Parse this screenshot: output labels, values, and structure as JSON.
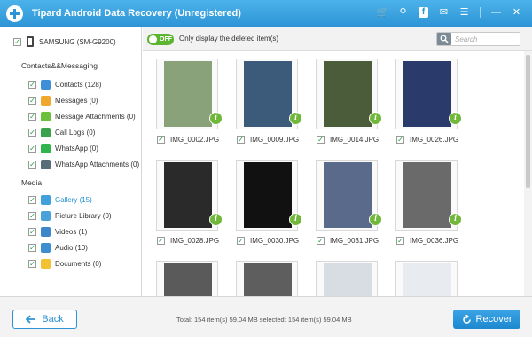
{
  "app": {
    "title": "Tipard Android Data Recovery (Unregistered)"
  },
  "device": {
    "name": "SAMSUNG (SM-G9200)"
  },
  "sidebar": {
    "contacts_section": "Contacts&&Messaging",
    "media_section": "Media",
    "contacts_items": [
      {
        "label": "Contacts (128)",
        "icon": "contacts-icon",
        "color": "#3f8fd6"
      },
      {
        "label": "Messages (0)",
        "icon": "messages-icon",
        "color": "#f0a82c"
      },
      {
        "label": "Message Attachments (0)",
        "icon": "attachment-icon",
        "color": "#6cbf3a"
      },
      {
        "label": "Call Logs (0)",
        "icon": "call-log-icon",
        "color": "#3aa24a"
      },
      {
        "label": "WhatsApp (0)",
        "icon": "whatsapp-icon",
        "color": "#2fb54c"
      },
      {
        "label": "WhatsApp Attachments (0)",
        "icon": "whatsapp-attachment-icon",
        "color": "#5a6e7a"
      }
    ],
    "media_items": [
      {
        "label": "Gallery (15)",
        "icon": "gallery-icon",
        "color": "#3fa0dc",
        "active": true
      },
      {
        "label": "Picture Library (0)",
        "icon": "picture-library-icon",
        "color": "#4aa0d8"
      },
      {
        "label": "Videos (1)",
        "icon": "videos-icon",
        "color": "#3d86c9"
      },
      {
        "label": "Audio (10)",
        "icon": "audio-icon",
        "color": "#3d8ed0"
      },
      {
        "label": "Documents (0)",
        "icon": "documents-icon",
        "color": "#f2c232"
      }
    ]
  },
  "filter": {
    "toggle_label": "OFF",
    "text": "Only display the deleted item(s)",
    "search_placeholder": "Search"
  },
  "gallery": {
    "items": [
      {
        "name": "IMG_0002.JPG",
        "tint": "#8aa27a"
      },
      {
        "name": "IMG_0009.JPG",
        "tint": "#3c5a7a"
      },
      {
        "name": "IMG_0014.JPG",
        "tint": "#4a5c3a"
      },
      {
        "name": "IMG_0026.JPG",
        "tint": "#2a3a6a"
      },
      {
        "name": "IMG_0028.JPG",
        "tint": "#2a2a2a"
      },
      {
        "name": "IMG_0030.JPG",
        "tint": "#111111"
      },
      {
        "name": "IMG_0031.JPG",
        "tint": "#5a6a8a"
      },
      {
        "name": "IMG_0036.JPG",
        "tint": "#6a6a6a"
      },
      {
        "name": "",
        "tint": "#5a5a5a"
      },
      {
        "name": "",
        "tint": "#5e5e5e"
      },
      {
        "name": "",
        "tint": "#d8dde4"
      },
      {
        "name": "",
        "tint": "#e8ecf0"
      }
    ]
  },
  "bottom": {
    "back_label": "Back",
    "status": "Total: 154 item(s) 59.04 MB   selected: 154 item(s) 59.04 MB",
    "recover_label": "Recover"
  }
}
